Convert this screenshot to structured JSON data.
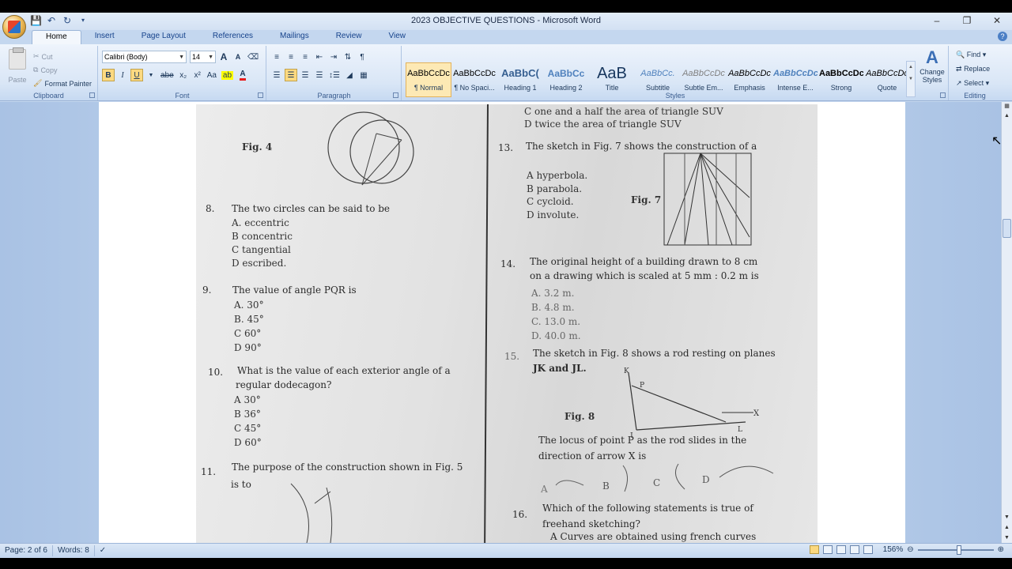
{
  "window": {
    "title": "2023 OBJECTIVE QUESTIONS - Microsoft Word",
    "controls": {
      "minimize": "–",
      "restore": "❐",
      "close": "✕"
    }
  },
  "ribbon_tabs": [
    "Home",
    "Insert",
    "Page Layout",
    "References",
    "Mailings",
    "Review",
    "View"
  ],
  "clipboard": {
    "label": "Clipboard",
    "paste": "Paste",
    "cut": "Cut",
    "copy": "Copy",
    "format_painter": "Format Painter"
  },
  "font": {
    "label": "Font",
    "family": "Calibri (Body)",
    "size": "14",
    "bold": "B",
    "italic": "I",
    "underline": "U",
    "strike": "abe",
    "subscript": "x₂",
    "superscript": "x²",
    "change_case": "Aa",
    "grow": "A",
    "shrink": "A"
  },
  "paragraph": {
    "label": "Paragraph"
  },
  "styles": {
    "label": "Styles",
    "items": [
      {
        "preview": "AaBbCcDc",
        "name": "¶ Normal"
      },
      {
        "preview": "AaBbCcDc",
        "name": "¶ No Spaci..."
      },
      {
        "preview": "AaBbC(",
        "name": "Heading 1"
      },
      {
        "preview": "AaBbCc",
        "name": "Heading 2"
      },
      {
        "preview": "AaB",
        "name": "Title"
      },
      {
        "preview": "AaBbCc.",
        "name": "Subtitle"
      },
      {
        "preview": "AaBbCcDc",
        "name": "Subtle Em..."
      },
      {
        "preview": "AaBbCcDc",
        "name": "Emphasis"
      },
      {
        "preview": "AaBbCcDc",
        "name": "Intense E..."
      },
      {
        "preview": "AaBbCcDc",
        "name": "Strong"
      },
      {
        "preview": "AaBbCcDc",
        "name": "Quote"
      }
    ],
    "change_styles": "Change Styles"
  },
  "editing": {
    "label": "Editing",
    "find": "Find",
    "replace": "Replace",
    "select": "Select"
  },
  "document": {
    "left": {
      "fig4": "Fig. 4",
      "q8": {
        "num": "8.",
        "text": "The two circles can be said to be",
        "options": [
          "A.  eccentric",
          "B   concentric",
          "C   tangential",
          "D   escribed."
        ]
      },
      "q9": {
        "num": "9.",
        "text": "The value of angle PQR is",
        "options": [
          "A.   30°",
          "B.   45°",
          "C   60°",
          "D   90°"
        ]
      },
      "q10": {
        "num": "10.",
        "text": "What is the value of each exterior angle of a",
        "text2": "regular dodecagon?",
        "options": [
          "A   30°",
          "B   36°",
          "C   45°",
          "D   60°"
        ]
      },
      "q11": {
        "num": "11.",
        "text": "The purpose of the construction shown in Fig. 5",
        "text2": "is to"
      }
    },
    "right": {
      "prev_opts": [
        "C   one and a half the area of triangle SUV",
        "D   twice the area of triangle SUV"
      ],
      "q13": {
        "num": "13.",
        "text": "The sketch in Fig. 7 shows the construction of a",
        "options": [
          "A   hyperbola.",
          "B   parabola.",
          "C   cycloid.",
          "D   involute."
        ]
      },
      "fig7": "Fig. 7",
      "q14": {
        "num": "14.",
        "text": "The original height of a building drawn to 8 cm",
        "text2": "on a drawing which is scaled at 5 mm : 0.2 m is",
        "options": [
          "A.     3.2 m.",
          "B.     4.8 m.",
          "C.    13.0 m.",
          "D.    40.0 m."
        ]
      },
      "q15": {
        "num": "15.",
        "text": "The sketch in Fig. 8 shows a rod resting on planes",
        "text2": "JK and JL.",
        "text3": "The locus  of point P as the rod slides in the",
        "text4": "direction of arrow X is"
      },
      "fig8": "Fig. 8",
      "fig8_labels": {
        "k": "K",
        "p": "P",
        "j": "J",
        "l": "L",
        "x": "X"
      },
      "q15_opts": [
        "A",
        "B",
        "C",
        "D"
      ],
      "q16": {
        "num": "16.",
        "text": "Which of the following statements is true of",
        "text2": "freehand sketching?",
        "text3": "A   Curves are obtained using french curves"
      }
    }
  },
  "status": {
    "page": "Page: 2 of 6",
    "words": "Words: 8",
    "zoom": "156%"
  }
}
